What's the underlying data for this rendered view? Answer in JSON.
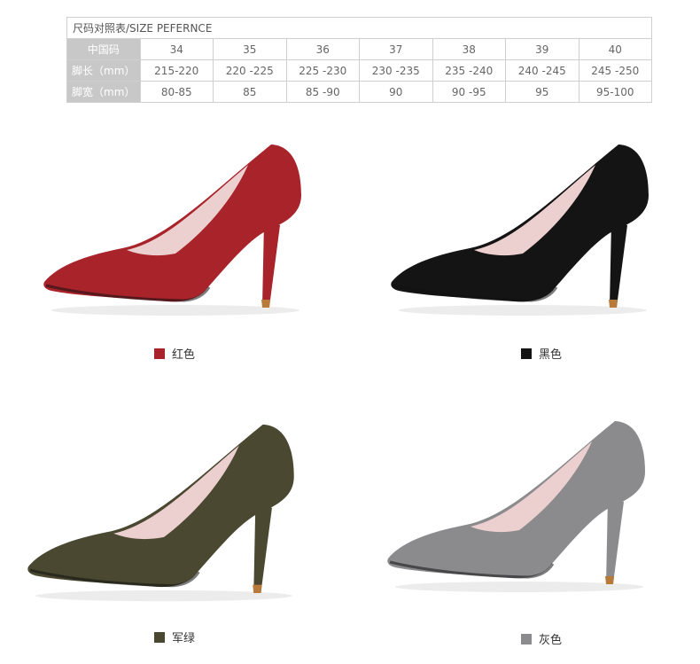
{
  "size_table": {
    "caption": "尺码对照表/SIZE PEFERNCE",
    "rows": [
      {
        "label": "中国码",
        "cells": [
          "34",
          "35",
          "36",
          "37",
          "38",
          "39",
          "40"
        ]
      },
      {
        "label": "脚长（mm）",
        "cells": [
          "215-220",
          "220 -225",
          "225 -230",
          "230 -235",
          "235 -240",
          "240 -245",
          "245 -250"
        ]
      },
      {
        "label": "脚宽（mm）",
        "cells": [
          "80-85",
          "85",
          "85 -90",
          "90",
          "90 -95",
          "95",
          "95-100"
        ]
      }
    ]
  },
  "products": [
    {
      "name": "红色",
      "color": "#a9232b",
      "heel_tip": "#b77a3a"
    },
    {
      "name": "黑色",
      "color": "#141414",
      "heel_tip": "#b77a3a"
    },
    {
      "name": "军绿",
      "color": "#4a4830",
      "heel_tip": "#b77a3a"
    },
    {
      "name": "灰色",
      "color": "#8b8b8e",
      "heel_tip": "#b77a3a"
    }
  ],
  "lining_color": "#eccfcf"
}
